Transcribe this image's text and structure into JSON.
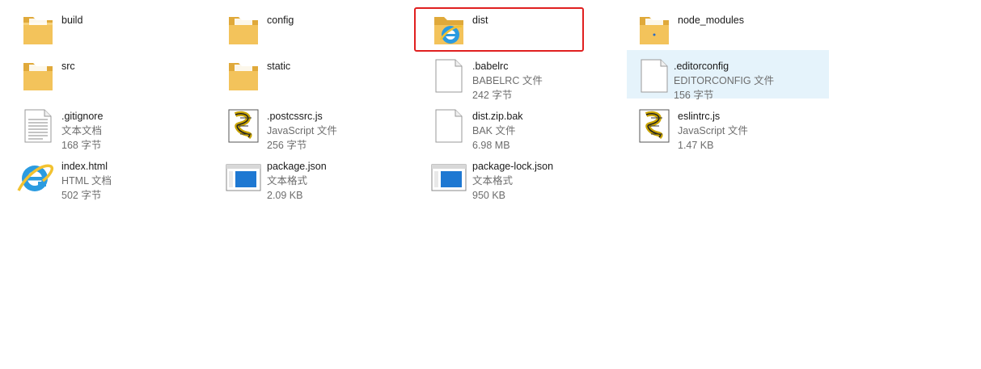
{
  "items": [
    {
      "name": "build",
      "type": "",
      "size": "",
      "icon": "folder-icon"
    },
    {
      "name": "config",
      "type": "",
      "size": "",
      "icon": "folder-icon"
    },
    {
      "name": "dist",
      "type": "",
      "size": "",
      "icon": "folder-ie-icon"
    },
    {
      "name": "node_modules",
      "type": "",
      "size": "",
      "icon": "folder-icon"
    },
    {
      "name": "src",
      "type": "",
      "size": "",
      "icon": "folder-icon"
    },
    {
      "name": "static",
      "type": "",
      "size": "",
      "icon": "folder-icon"
    },
    {
      "name": ".babelrc",
      "type": "BABELRC 文件",
      "size": "242 字节",
      "icon": "blank-file-icon"
    },
    {
      "name": ".editorconfig",
      "type": "EDITORCONFIG 文件",
      "size": "156 字节",
      "icon": "blank-file-icon"
    },
    {
      "name": ".gitignore",
      "type": "文本文档",
      "size": "168 字节",
      "icon": "text-document-icon"
    },
    {
      "name": ".postcssrc.js",
      "type": "JavaScript 文件",
      "size": "256 字节",
      "icon": "javascript-file-icon"
    },
    {
      "name": "dist.zip.bak",
      "type": "BAK 文件",
      "size": "6.98 MB",
      "icon": "blank-file-icon"
    },
    {
      "name": "eslintrc.js",
      "type": "JavaScript 文件",
      "size": "1.47 KB",
      "icon": "javascript-file-icon"
    },
    {
      "name": "index.html",
      "type": "HTML 文档",
      "size": "502 字节",
      "icon": "ie-html-icon"
    },
    {
      "name": "package.json",
      "type": "文本格式",
      "size": "2.09 KB",
      "icon": "json-file-icon"
    },
    {
      "name": "package-lock.json",
      "type": "文本格式",
      "size": "950 KB",
      "icon": "json-file-icon"
    }
  ],
  "selected_item": ".editorconfig",
  "highlighted_item": "dist",
  "colors": {
    "highlight": "#e02020",
    "selection": "#e5f3fb",
    "folder": "#f3c35b",
    "meta_text": "#6d6d6d"
  }
}
